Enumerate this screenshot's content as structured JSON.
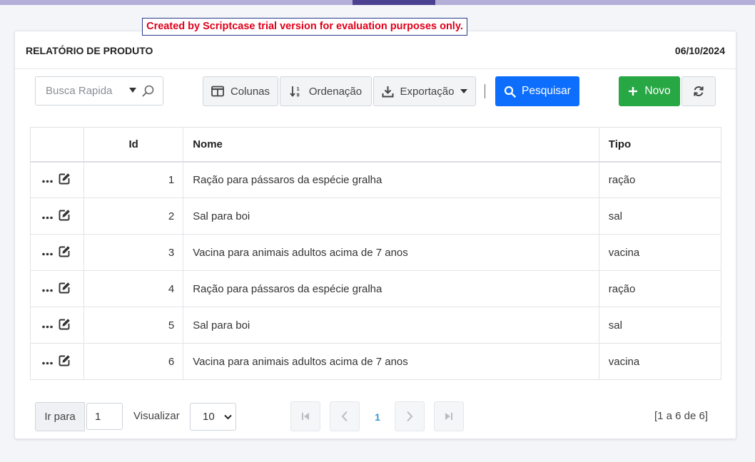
{
  "trial_banner": "Created by Scriptcase trial version for evaluation purposes only.",
  "header": {
    "title": "RELATÓRIO DE PRODUTO",
    "date": "06/10/2024"
  },
  "toolbar": {
    "search_placeholder": "Busca Rapida",
    "colunas": "Colunas",
    "ordenacao": "Ordenação",
    "exportacao": "Exportação",
    "pesquisar": "Pesquisar",
    "novo": "Novo"
  },
  "table": {
    "headers": {
      "id": "Id",
      "nome": "Nome",
      "tipo": "Tipo"
    },
    "rows": [
      {
        "id": "1",
        "nome": "Ração para pássaros da espécie gralha",
        "tipo": "ração"
      },
      {
        "id": "2",
        "nome": "Sal para boi",
        "tipo": "sal"
      },
      {
        "id": "3",
        "nome": "Vacina para animais adultos acima de 7 anos",
        "tipo": "vacina"
      },
      {
        "id": "4",
        "nome": "Ração para pássaros da espécie gralha",
        "tipo": "ração"
      },
      {
        "id": "5",
        "nome": "Sal para boi",
        "tipo": "sal"
      },
      {
        "id": "6",
        "nome": "Vacina para animais adultos acima de 7 anos",
        "tipo": "vacina"
      }
    ]
  },
  "footer": {
    "ir_para": "Ir para",
    "page_input_value": "1",
    "visualizar": "Visualizar",
    "page_size": "10",
    "current_page": "1",
    "summary": "[1 a 6 de 6]"
  },
  "colors": {
    "primary": "#0d6efd",
    "success": "#28a745",
    "trial_text": "#e0001b",
    "topbar": "#b4afd8",
    "topbar_accent": "#4a4191",
    "page_link": "#2f9bd6"
  }
}
